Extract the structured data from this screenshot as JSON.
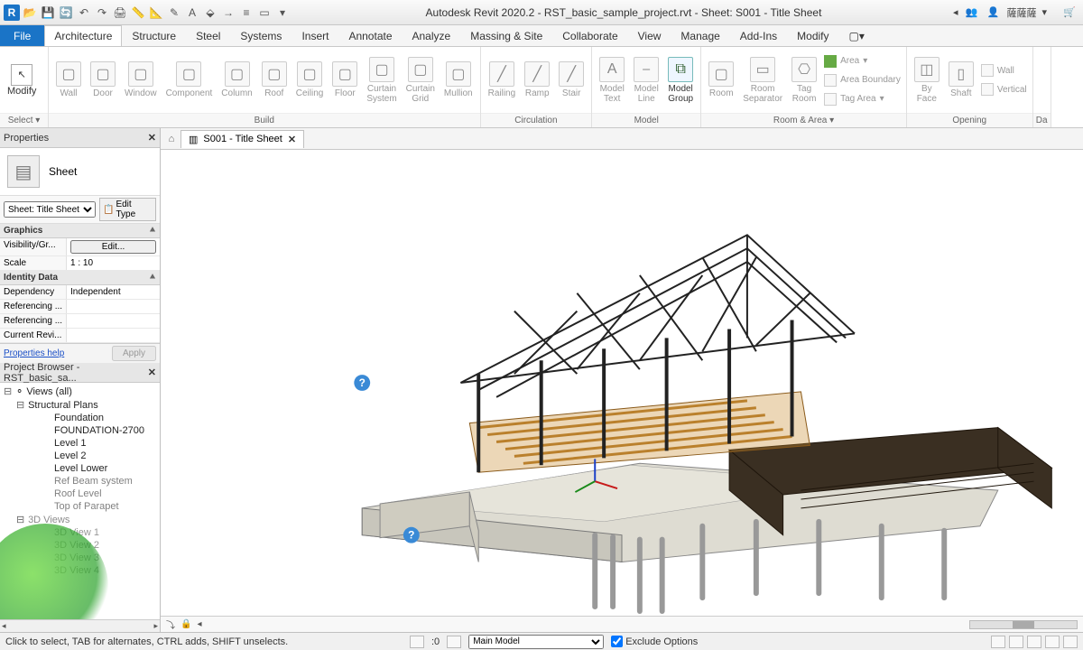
{
  "app": {
    "title": "Autodesk Revit 2020.2 - RST_basic_sample_project.rvt - Sheet: S001 - Title Sheet",
    "user": "薩薩薩"
  },
  "menu": {
    "file": "File",
    "tabs": [
      "Architecture",
      "Structure",
      "Steel",
      "Systems",
      "Insert",
      "Annotate",
      "Analyze",
      "Massing & Site",
      "Collaborate",
      "View",
      "Manage",
      "Add-Ins",
      "Modify"
    ],
    "active": "Architecture"
  },
  "ribbon": {
    "select": {
      "modify": "Modify",
      "select": "Select"
    },
    "build": {
      "label": "Build",
      "items": [
        "Wall",
        "Door",
        "Window",
        "Component",
        "Column",
        "Roof",
        "Ceiling",
        "Floor",
        "Curtain\nSystem",
        "Curtain\nGrid",
        "Mullion"
      ]
    },
    "circulation": {
      "label": "Circulation",
      "items": [
        "Railing",
        "Ramp",
        "Stair"
      ]
    },
    "model": {
      "label": "Model",
      "items": [
        "Model\nText",
        "Model\nLine",
        "Model\nGroup"
      ]
    },
    "roomarea": {
      "label": "Room & Area",
      "room": "Room",
      "separator": "Room\nSeparator",
      "tag": "Tag\nRoom",
      "area": "Area",
      "boundary": "Area\nBoundary",
      "tagarea": "Tag\nArea"
    },
    "opening": {
      "label": "Opening",
      "byface": "By\nFace",
      "shaft": "Shaft",
      "wall": "Wall",
      "vertical": "Vertical"
    },
    "datum": {
      "label": "Da"
    }
  },
  "properties": {
    "title": "Properties",
    "type": "Sheet",
    "instance": "Sheet: Title Sheet",
    "editType": "Edit Type",
    "sections": {
      "graphics": "Graphics",
      "identity": "Identity Data"
    },
    "rows": {
      "vis": "Visibility/Gr...",
      "vis_btn": "Edit...",
      "scale": "Scale",
      "scale_v": "1 : 10",
      "dep": "Dependency",
      "dep_v": "Independent",
      "ref1": "Referencing ...",
      "ref1_v": "",
      "ref2": "Referencing ...",
      "ref2_v": "",
      "rev": "Current Revi...",
      "rev_v": ""
    },
    "help": "Properties help",
    "apply": "Apply"
  },
  "browser": {
    "title": "Project Browser - RST_basic_sa...",
    "root": "Views (all)",
    "structural": "Structural Plans",
    "views3d": "3D Views",
    "plans": [
      "Foundation",
      "FOUNDATION-2700",
      "Level 1",
      "Level 2",
      "Level Lower",
      "Ref Beam system",
      "Roof Level",
      "Top of Parapet"
    ],
    "threed": [
      "3D View 1",
      "3D View 2",
      "3D View 3",
      "3D View 4"
    ]
  },
  "viewtab": {
    "name": "S001 - Title Sheet"
  },
  "status": {
    "hint": "Click to select, TAB for alternates, CTRL adds, SHIFT unselects.",
    "zero": ":0",
    "model": "Main Model",
    "exclude": "Exclude Options"
  }
}
